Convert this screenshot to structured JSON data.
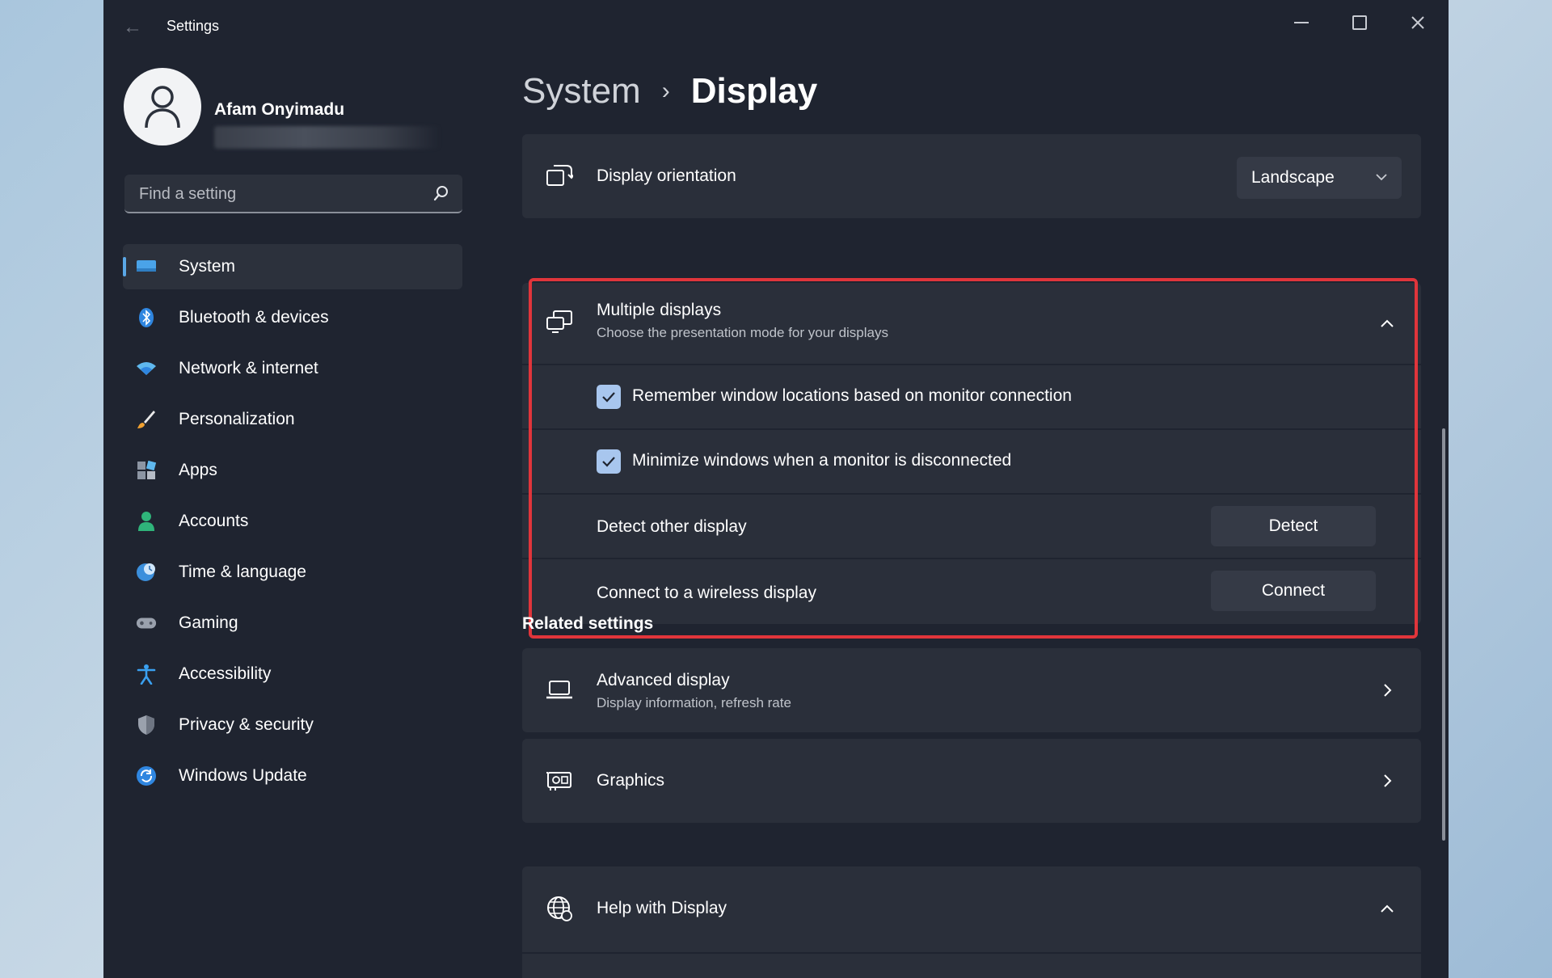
{
  "window": {
    "title": "Settings",
    "controls": [
      "minimize",
      "maximize",
      "close"
    ]
  },
  "profile": {
    "name": "Afam Onyimadu"
  },
  "search": {
    "placeholder": "Find a setting"
  },
  "sidebar": {
    "items": [
      {
        "label": "System",
        "icon": "system-icon",
        "active": true
      },
      {
        "label": "Bluetooth & devices",
        "icon": "bluetooth-icon"
      },
      {
        "label": "Network & internet",
        "icon": "wifi-icon"
      },
      {
        "label": "Personalization",
        "icon": "brush-icon"
      },
      {
        "label": "Apps",
        "icon": "apps-icon"
      },
      {
        "label": "Accounts",
        "icon": "person-icon"
      },
      {
        "label": "Time & language",
        "icon": "globe-clock-icon"
      },
      {
        "label": "Gaming",
        "icon": "gamepad-icon"
      },
      {
        "label": "Accessibility",
        "icon": "accessibility-icon"
      },
      {
        "label": "Privacy & security",
        "icon": "shield-icon"
      },
      {
        "label": "Windows Update",
        "icon": "update-icon"
      }
    ]
  },
  "breadcrumb": {
    "parent": "System",
    "separator": "›",
    "current": "Display"
  },
  "orientation": {
    "label": "Display orientation",
    "value": "Landscape"
  },
  "multiple_displays": {
    "title": "Multiple displays",
    "subtitle": "Choose the presentation mode for your displays",
    "remember_label": "Remember window locations based on monitor connection",
    "remember_checked": true,
    "minimize_label": "Minimize windows when a monitor is disconnected",
    "minimize_checked": true,
    "detect_label": "Detect other display",
    "detect_button": "Detect",
    "connect_label": "Connect to a wireless display",
    "connect_button": "Connect"
  },
  "related": {
    "title": "Related settings",
    "advanced_title": "Advanced display",
    "advanced_subtitle": "Display information, refresh rate",
    "graphics_title": "Graphics"
  },
  "help": {
    "title": "Help with Display"
  },
  "colors": {
    "window_bg": "#1f2430",
    "card_bg": "#2a2f3a",
    "accent": "#5aa7e6",
    "highlight_border": "#e0353b",
    "checkbox": "#a8c6ee"
  }
}
